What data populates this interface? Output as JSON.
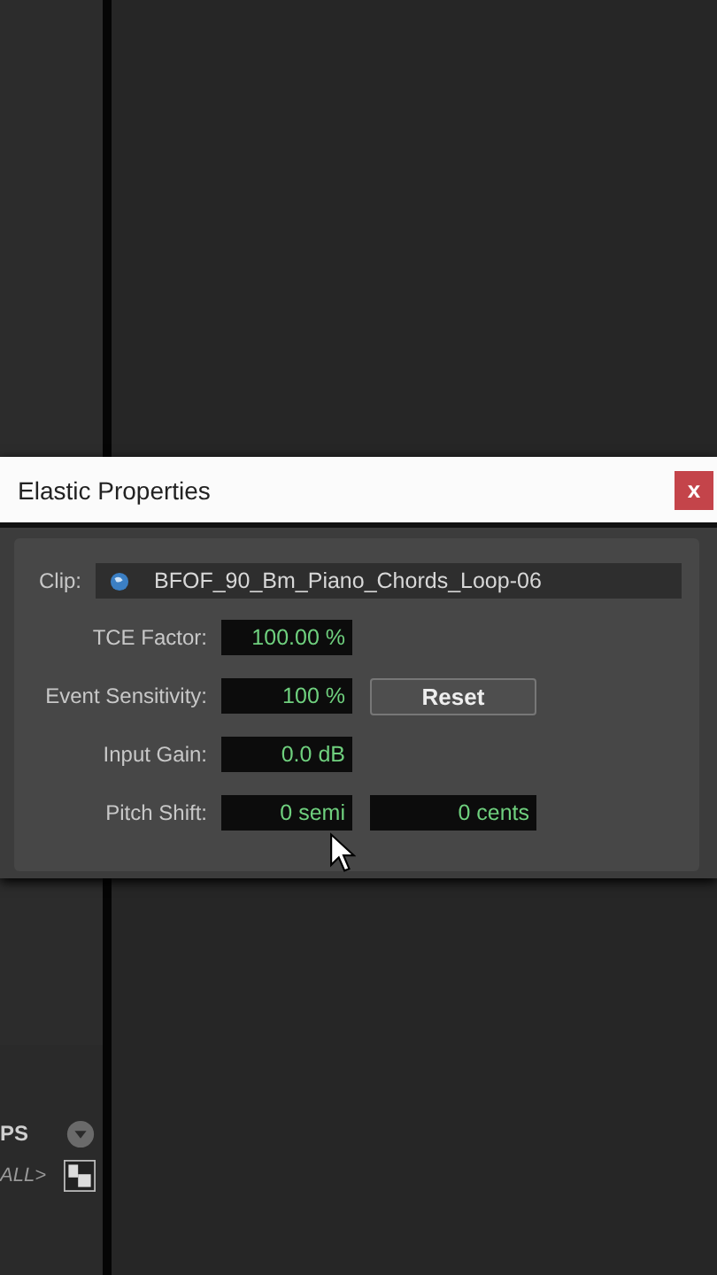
{
  "dialog": {
    "title": "Elastic Properties",
    "close": "x",
    "clip": {
      "label": "Clip:",
      "name": "BFOF_90_Bm_Piano_Chords_Loop-06"
    },
    "fields": [
      {
        "label": "TCE Factor:",
        "values": [
          "100.00 %"
        ]
      },
      {
        "label": "Event Sensitivity:",
        "values": [
          "100 %"
        ],
        "button": "Reset"
      },
      {
        "label": "Input Gain:",
        "values": [
          "0.0 dB"
        ]
      },
      {
        "label": "Pitch Shift:",
        "values": [
          "0 semi",
          "0 cents"
        ]
      }
    ]
  },
  "side_panel": {
    "rows": [
      {
        "kind": "dropdown",
        "label": "PS"
      },
      {
        "kind": "toggle",
        "label": "ALL>"
      }
    ]
  }
}
